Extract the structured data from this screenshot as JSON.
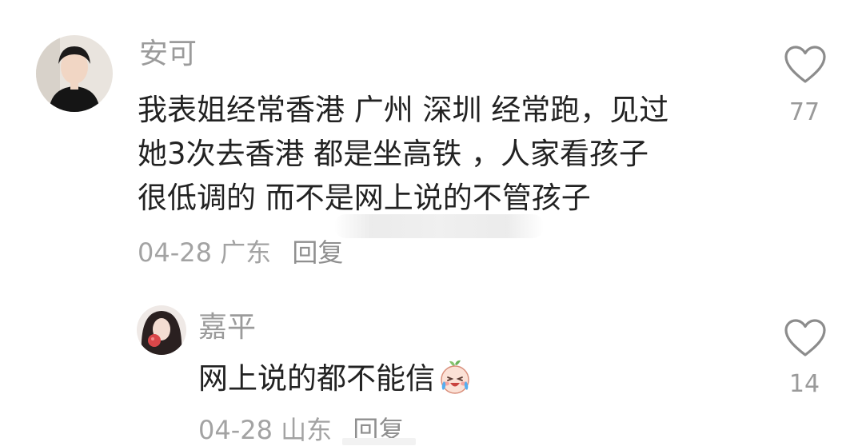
{
  "comments": [
    {
      "user": "安可",
      "text_lines": [
        "我表姐经常香港 广州 深圳 经常跑，见过",
        "她3次去香港 都是坐高铁 ，人家看孩子",
        "很低调的 而不是网上说的不管孩子"
      ],
      "date": "04-28",
      "location": "广东",
      "reply_label": "回复",
      "likes": "77"
    },
    {
      "user": "嘉平",
      "text": "网上说的都不能信",
      "emoji": "crying-laughing-peach-emoji",
      "date": "04-28",
      "location": "山东",
      "reply_label": "回复",
      "likes": "14"
    }
  ],
  "icons": {
    "like": "heart-outline-icon"
  },
  "colors": {
    "username": "#9b9b9b",
    "text": "#222222",
    "meta": "#a3a3a3",
    "icon": "#8c8c8c"
  }
}
